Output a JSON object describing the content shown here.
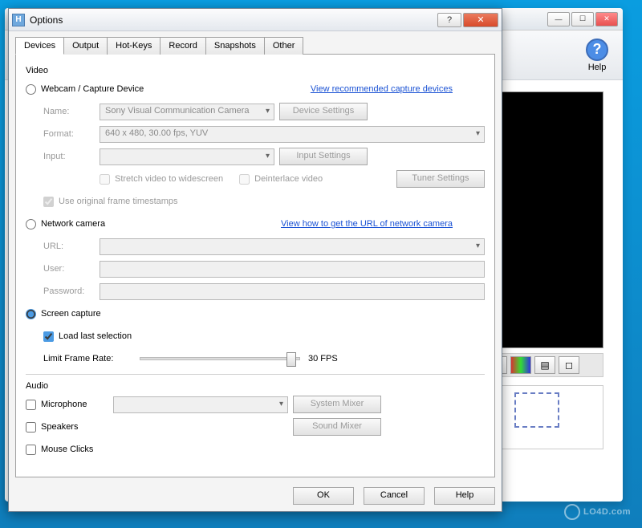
{
  "main_window": {
    "help_label": "Help"
  },
  "dialog": {
    "title": "Options",
    "tabs": [
      "Devices",
      "Output",
      "Hot-Keys",
      "Record",
      "Snapshots",
      "Other"
    ],
    "video": {
      "group_label": "Video",
      "webcam_radio": "Webcam / Capture Device",
      "recommended_link": "View recommended capture devices",
      "name_label": "Name:",
      "name_value": "Sony Visual Communication Camera",
      "device_settings_btn": "Device Settings",
      "format_label": "Format:",
      "format_value": "640 x 480, 30.00 fps, YUV",
      "input_label": "Input:",
      "input_value": "",
      "input_settings_btn": "Input Settings",
      "stretch_label": "Stretch video to widescreen",
      "deinterlace_label": "Deinterlace video",
      "tuner_settings_btn": "Tuner Settings",
      "timestamps_label": "Use original frame timestamps",
      "network_radio": "Network camera",
      "network_link": "View how to get the URL of network camera",
      "url_label": "URL:",
      "user_label": "User:",
      "password_label": "Password:",
      "screen_radio": "Screen capture",
      "load_last_label": "Load last selection",
      "limit_frame_label": "Limit Frame Rate:",
      "fps_value": "30 FPS"
    },
    "audio": {
      "group_label": "Audio",
      "microphone_label": "Microphone",
      "system_mixer_btn": "System Mixer",
      "speakers_label": "Speakers",
      "sound_mixer_btn": "Sound Mixer",
      "mouse_clicks_label": "Mouse Clicks"
    },
    "footer": {
      "ok": "OK",
      "cancel": "Cancel",
      "help": "Help"
    }
  },
  "watermark": "LO4D.com"
}
